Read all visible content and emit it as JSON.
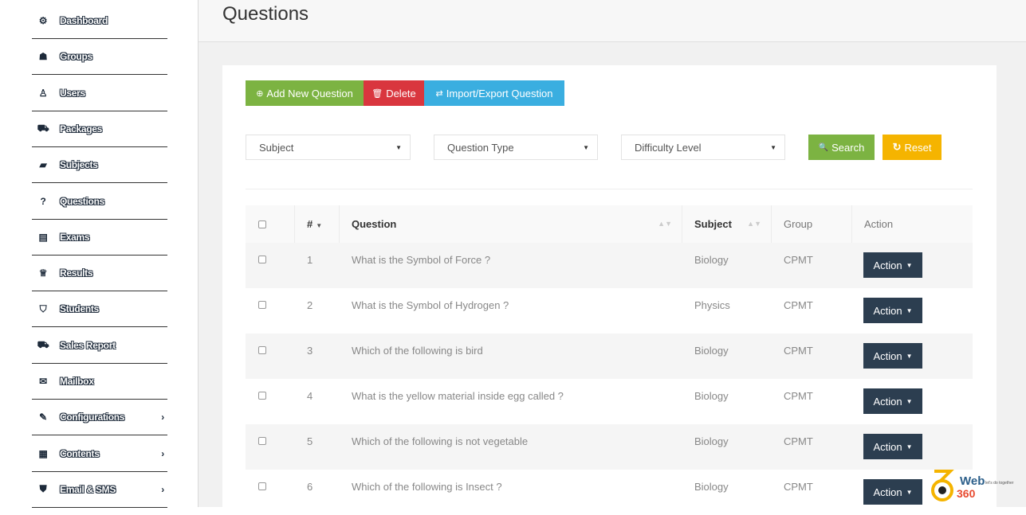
{
  "sidebar": {
    "items": [
      {
        "label": "Dashboard",
        "icon": "dashboard-icon",
        "glyph": "⚙",
        "has_submenu": false
      },
      {
        "label": "Groups",
        "icon": "groups-icon",
        "glyph": "☗",
        "has_submenu": false
      },
      {
        "label": "Users",
        "icon": "users-icon",
        "glyph": "♙",
        "has_submenu": false
      },
      {
        "label": "Packages",
        "icon": "cart-icon",
        "glyph": "⛟",
        "has_submenu": false
      },
      {
        "label": "Subjects",
        "icon": "book-icon",
        "glyph": "▰",
        "has_submenu": false
      },
      {
        "label": "Questions",
        "icon": "question-icon",
        "glyph": "?",
        "has_submenu": false
      },
      {
        "label": "Exams",
        "icon": "list-icon",
        "glyph": "▤",
        "has_submenu": false
      },
      {
        "label": "Results",
        "icon": "trophy-icon",
        "glyph": "♕",
        "has_submenu": false
      },
      {
        "label": "Students",
        "icon": "graduation-cap-icon",
        "glyph": "⛉",
        "has_submenu": false
      },
      {
        "label": "Sales Report",
        "icon": "cart-icon",
        "glyph": "⛟",
        "has_submenu": false
      },
      {
        "label": "Mailbox",
        "icon": "envelope-icon",
        "glyph": "✉",
        "has_submenu": false
      },
      {
        "label": "Configurations",
        "icon": "wrench-icon",
        "glyph": "✎",
        "has_submenu": true
      },
      {
        "label": "Contents",
        "icon": "newspaper-icon",
        "glyph": "▦",
        "has_submenu": true
      },
      {
        "label": "Email & SMS",
        "icon": "shield-icon",
        "glyph": "⛊",
        "has_submenu": true
      }
    ],
    "chevron": "›"
  },
  "header": {
    "title": "Questions"
  },
  "toolbar": {
    "add_label": "Add New Question",
    "add_glyph": "⊕",
    "delete_label": "Delete",
    "delete_glyph": "🗑",
    "import_label": "Import/Export Question",
    "import_glyph": "⇄"
  },
  "filters": {
    "subject": "Subject",
    "question_type": "Question Type",
    "difficulty": "Difficulty Level",
    "caret": "▼",
    "search_label": "Search",
    "search_glyph": "🔍",
    "reset_label": "Reset",
    "reset_glyph": "↻"
  },
  "table": {
    "headers": {
      "num": "#",
      "question": "Question",
      "subject": "Subject",
      "group": "Group",
      "action": "Action"
    },
    "sort_glyphs": {
      "num": "▼",
      "sortable": "▲▼"
    },
    "action_label": "Action",
    "action_caret": "▼",
    "rows": [
      {
        "num": "1",
        "question": "What is the Symbol of Force ?",
        "subject": "Biology",
        "group": "CPMT"
      },
      {
        "num": "2",
        "question": "What is the Symbol of Hydrogen ?",
        "subject": "Physics",
        "group": "CPMT"
      },
      {
        "num": "3",
        "question": "Which of the following is bird",
        "subject": "Biology",
        "group": "CPMT"
      },
      {
        "num": "4",
        "question": "What is the yellow material inside egg called ?",
        "subject": "Biology",
        "group": "CPMT"
      },
      {
        "num": "5",
        "question": "Which of the following is not vegetable",
        "subject": "Biology",
        "group": "CPMT"
      },
      {
        "num": "6",
        "question": "Which of the following is Insect ?",
        "subject": "Biology",
        "group": "CPMT"
      }
    ]
  },
  "watermark": {
    "logo_text": "Web",
    "logo_num": "360",
    "tagline": "let's do together"
  },
  "colors": {
    "green": "#7cb342",
    "red": "#d9363e",
    "blue": "#3aaee0",
    "orange": "#f5b400",
    "navy": "#2c3e50"
  }
}
